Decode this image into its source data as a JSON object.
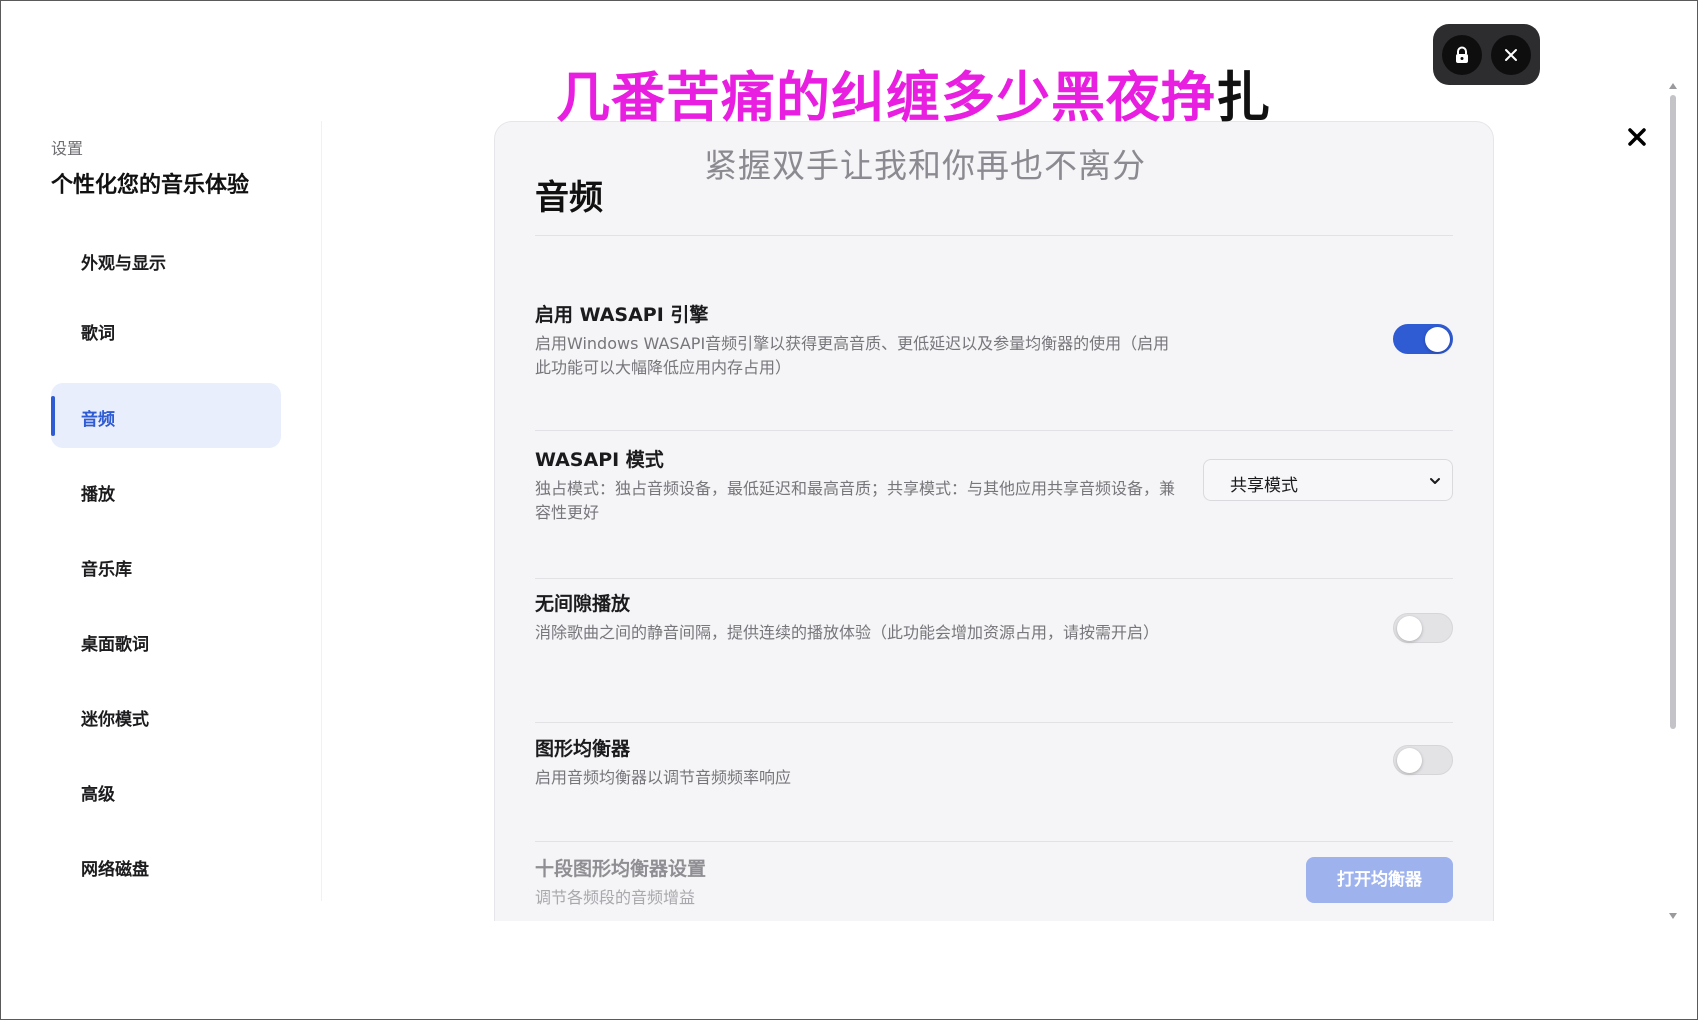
{
  "lyrics": {
    "line1_highlight": "几番苦痛的纠缠多少黑夜挣",
    "line1_rest": "扎",
    "line2": "紧握双手让我和你再也不离分"
  },
  "sidebar": {
    "kicker": "设置",
    "title": "个性化您的音乐体验",
    "items": [
      {
        "label": "外观与显示"
      },
      {
        "label": "歌词"
      },
      {
        "label": "音频",
        "active": true
      },
      {
        "label": "播放"
      },
      {
        "label": "音乐库"
      },
      {
        "label": "桌面歌词"
      },
      {
        "label": "迷你模式"
      },
      {
        "label": "高级"
      },
      {
        "label": "网络磁盘"
      }
    ]
  },
  "section": {
    "title": "音频",
    "settings": [
      {
        "title": "启用 WASAPI 引擎",
        "desc": "启用Windows WASAPI音频引擎以获得更高音质、更低延迟以及参量均衡器的使用（启用此功能可以大幅降低应用内存占用）",
        "control": "toggle",
        "on": true
      },
      {
        "title": "WASAPI 模式",
        "desc": "独占模式：独占音频设备，最低延迟和最高音质；共享模式：与其他应用共享音频设备，兼容性更好",
        "control": "select",
        "value": "共享模式"
      },
      {
        "title": "无间隙播放",
        "desc": "消除歌曲之间的静音间隔，提供连续的播放体验（此功能会增加资源占用，请按需开启）",
        "control": "toggle",
        "on": false
      },
      {
        "title": "图形均衡器",
        "desc": "启用音频均衡器以调节音频频率响应",
        "control": "toggle",
        "on": false
      },
      {
        "title": "十段图形均衡器设置",
        "desc": "调节各频段的音频增益",
        "control": "button",
        "button_label": "打开均衡器",
        "disabled": true
      }
    ]
  },
  "colors": {
    "accent": "#2f5bd3",
    "lyric_highlight": "#e81ee0",
    "active_nav_bg": "#e8eefc"
  },
  "icons": {
    "lock": "lock-icon",
    "lyric_close": "close-icon",
    "settings_close": "close-icon",
    "select_chevron": "chevron-down-icon"
  }
}
